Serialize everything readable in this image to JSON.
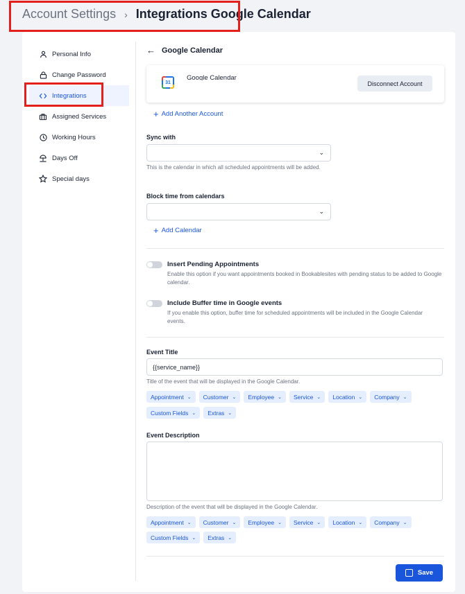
{
  "breadcrumb": {
    "root": "Account Settings",
    "separator": "›",
    "current": "Integrations Google Calendar"
  },
  "sidebar": {
    "items": [
      {
        "label": "Personal Info",
        "icon": "user-icon"
      },
      {
        "label": "Change Password",
        "icon": "lock-icon"
      },
      {
        "label": "Integrations",
        "icon": "code-icon",
        "active": true
      },
      {
        "label": "Assigned Services",
        "icon": "briefcase-icon"
      },
      {
        "label": "Working Hours",
        "icon": "clock-icon"
      },
      {
        "label": "Days Off",
        "icon": "beach-umbrella-icon"
      },
      {
        "label": "Special days",
        "icon": "star-icon"
      }
    ]
  },
  "main": {
    "back_title": "Google Calendar",
    "account": {
      "name": "Google Calendar",
      "logo_text": "31",
      "disconnect_label": "Disconnect Account"
    },
    "add_account_label": "Add Another Account",
    "sync_with": {
      "label": "Sync with",
      "value": "",
      "help": "This is the calendar in which all scheduled appointments will be added."
    },
    "block_time": {
      "label": "Block time from calendars",
      "value": "",
      "add_label": "Add Calendar"
    },
    "insert_pending": {
      "title": "Insert Pending Appointments",
      "help": "Enable this option if you want appointments booked in Bookablesites with pending status to be added to Google calendar.",
      "enabled": false
    },
    "include_buffer": {
      "title": "Include Buffer time in Google events",
      "help": "If you enable this option, buffer time for scheduled appointments will be included in the Google Calendar events.",
      "enabled": false
    },
    "event_title": {
      "label": "Event Title",
      "value": "{{service_name}}",
      "help": "Title of the event that will be displayed in the Google Calendar."
    },
    "event_description": {
      "label": "Event Description",
      "value": "",
      "help": "Description of the event that will be displayed in the Google Calendar."
    },
    "placeholder_chips": [
      "Appointment",
      "Customer",
      "Employee",
      "Service",
      "Location",
      "Company",
      "Custom Fields",
      "Extras"
    ],
    "save_label": "Save"
  },
  "colors": {
    "accent": "#1a56db",
    "chip_bg": "#e5eefe",
    "highlight_box": "#e3201b"
  }
}
